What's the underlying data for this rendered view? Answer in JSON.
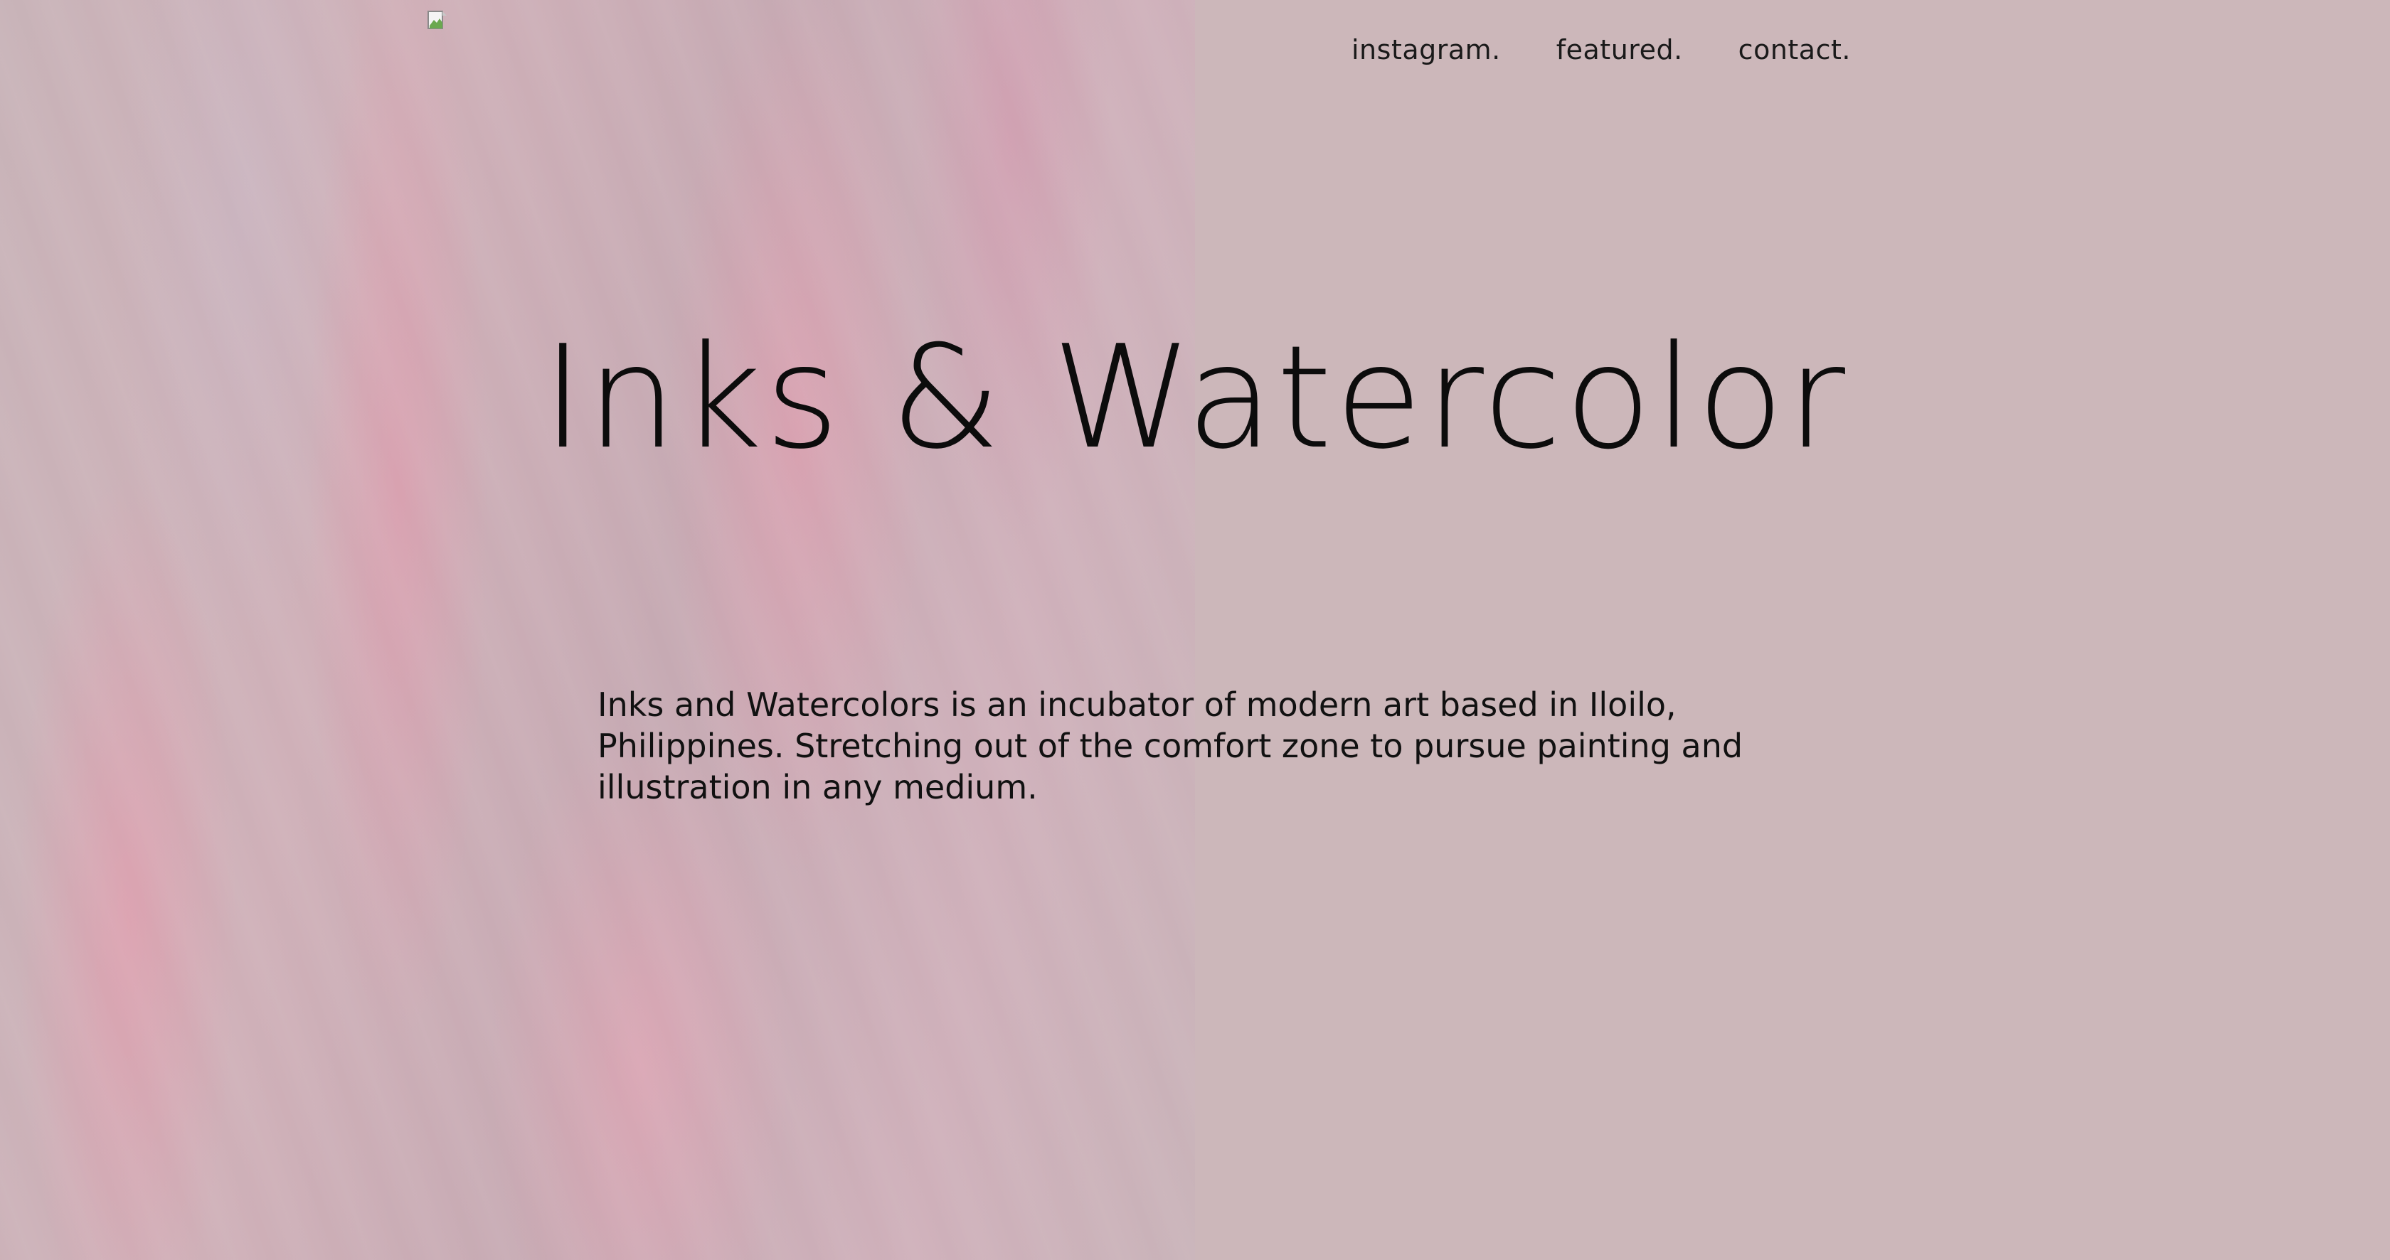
{
  "nav": {
    "items": [
      {
        "label": "instagram."
      },
      {
        "label": "featured."
      },
      {
        "label": "contact."
      }
    ]
  },
  "hero": {
    "title": "Inks & Watercolor",
    "description": "Inks and Watercolors is an incubator of modern art based in Iloilo, Philippines. Stretching out of the comfort zone to pursue painting and illustration in any medium."
  },
  "colors": {
    "background": "#ccb7ba",
    "text": "#111111"
  },
  "icons": {
    "logo": "broken-image-icon"
  }
}
